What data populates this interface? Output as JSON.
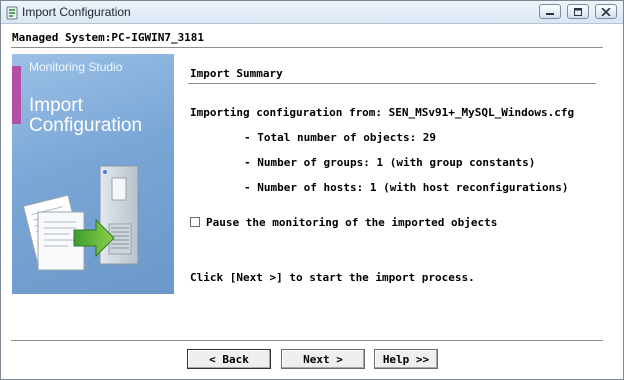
{
  "window": {
    "title": "Import Configuration",
    "icons": {
      "app": "app-icon",
      "minimize": "minimize-icon",
      "maximize": "maximize-icon",
      "close": "close-icon"
    }
  },
  "header": {
    "managed_system": "Managed System:PC-IGWIN7_3181"
  },
  "banner": {
    "product": "Monitoring Studio",
    "title_line1": "Import",
    "title_line2": "Configuration",
    "art_icon": "documents-to-server-icon",
    "accent_color": "#b34fa8"
  },
  "summary": {
    "section_title": "Import Summary",
    "importing_from": "Importing configuration from: SEN_MSv91+_MySQL_Windows.cfg",
    "total_objects": "- Total number of objects: 29",
    "groups": "- Number of groups: 1 (with group constants)",
    "hosts": "- Number of hosts: 1 (with host reconfigurations)"
  },
  "options": {
    "pause_label": "Pause the monitoring of the imported objects",
    "pause_checked": false
  },
  "instruction": "Click [Next >] to start the import process.",
  "buttons": {
    "back": "< Back",
    "next": "Next >",
    "help": "Help >>"
  }
}
